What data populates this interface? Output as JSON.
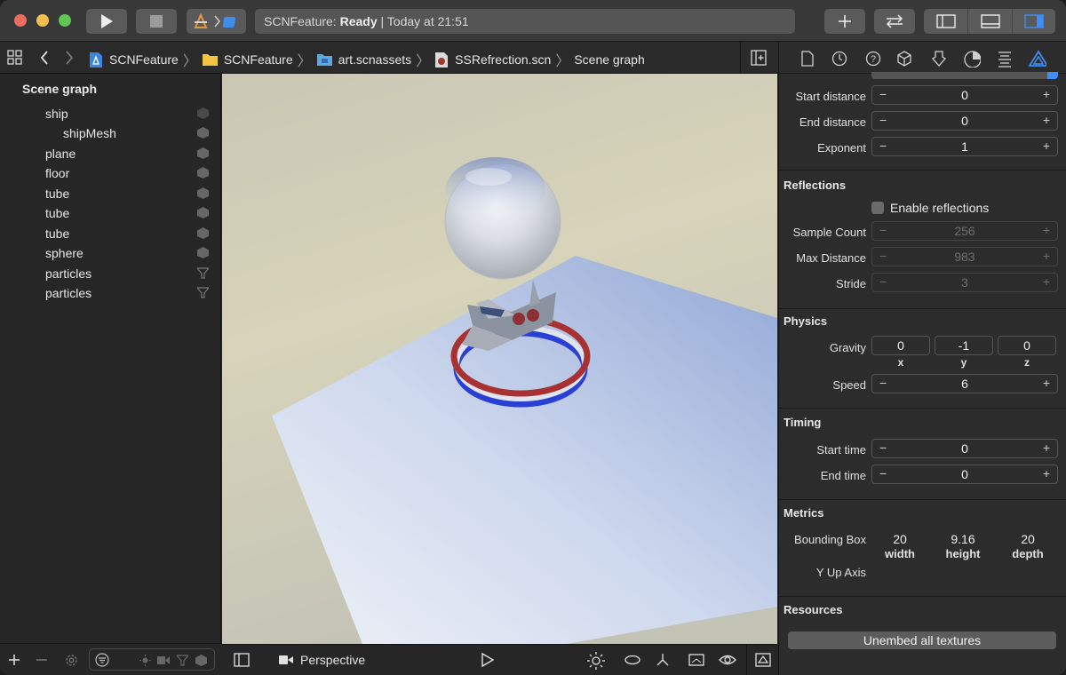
{
  "toolbar": {
    "status_app": "SCNFeature: ",
    "status_state": "Ready",
    "status_time": " | Today at 21:51"
  },
  "breadcrumb": {
    "items": [
      "SCNFeature",
      "SCNFeature",
      "art.scnassets",
      "SSRefrection.scn",
      "Scene graph"
    ]
  },
  "navigator": {
    "title": "Scene graph",
    "nodes": [
      {
        "label": "ship",
        "kind": "node-cube-icon"
      },
      {
        "label": "shipMesh",
        "kind": "node-cube-icon"
      },
      {
        "label": "plane",
        "kind": "node-cube-icon"
      },
      {
        "label": "floor",
        "kind": "node-cube-icon"
      },
      {
        "label": "tube",
        "kind": "node-cube-icon"
      },
      {
        "label": "tube",
        "kind": "node-cube-icon"
      },
      {
        "label": "tube",
        "kind": "node-cube-icon"
      },
      {
        "label": "sphere",
        "kind": "node-cube-icon"
      },
      {
        "label": "particles",
        "kind": "particle-funnel-icon"
      },
      {
        "label": "particles",
        "kind": "particle-funnel-icon"
      }
    ]
  },
  "viewport": {
    "camera_label": "Perspective"
  },
  "inspector": {
    "fog": {
      "start_distance_label": "Start distance",
      "start_distance": "0",
      "end_distance_label": "End distance",
      "end_distance": "0",
      "exponent_label": "Exponent",
      "exponent": "1"
    },
    "reflections": {
      "title": "Reflections",
      "enable_label": "Enable reflections",
      "sample_count_label": "Sample Count",
      "sample_count": "256",
      "max_distance_label": "Max Distance",
      "max_distance": "983",
      "stride_label": "Stride",
      "stride": "3"
    },
    "physics": {
      "title": "Physics",
      "gravity_label": "Gravity",
      "gravity": {
        "x": "0",
        "y": "-1",
        "z": "0"
      },
      "axis": {
        "x": "x",
        "y": "y",
        "z": "z"
      },
      "speed_label": "Speed",
      "speed": "6"
    },
    "timing": {
      "title": "Timing",
      "start_time_label": "Start time",
      "start_time": "0",
      "end_time_label": "End time",
      "end_time": "0"
    },
    "metrics": {
      "title": "Metrics",
      "bbox_label": "Bounding Box",
      "width": "20",
      "height": "9.16",
      "depth": "20",
      "width_label": "width",
      "height_label": "height",
      "depth_label": "depth",
      "y_up_label": "Y Up Axis"
    },
    "resources": {
      "title": "Resources",
      "unembed_label": "Unembed all textures"
    },
    "stepper_minus": "−",
    "stepper_plus": "+"
  },
  "colors": {
    "accent": "#3b8ff6",
    "ring_red": "#a83232",
    "ring_blue": "#2a3fd6"
  }
}
